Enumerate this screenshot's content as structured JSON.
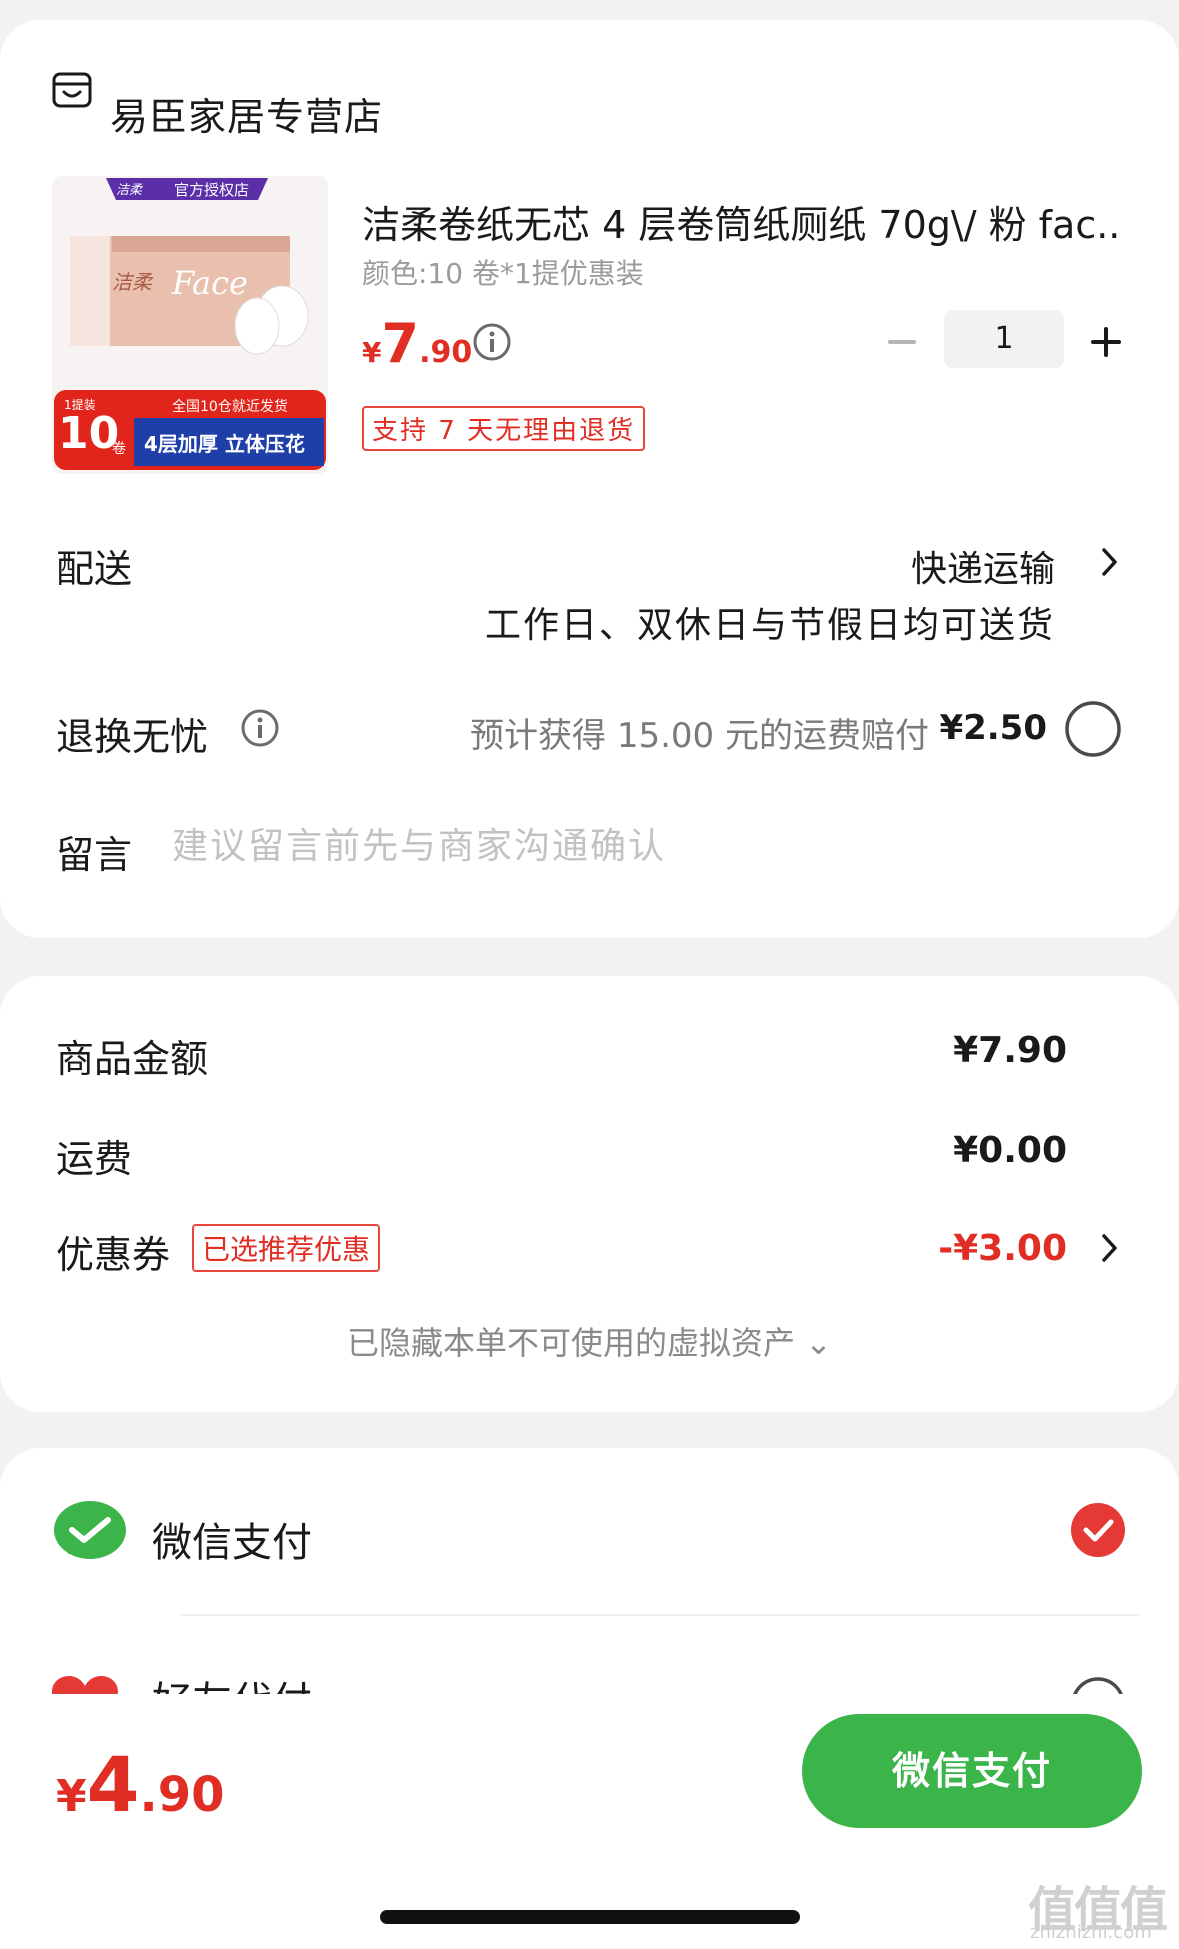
{
  "store": {
    "name": "易臣家居专营店",
    "icon": "store-icon"
  },
  "product": {
    "title": "洁柔卷纸无芯 4 层卷筒纸厕纸 70g\\/ 粉 fac...",
    "variant": "颜色:10 卷*1提优惠装",
    "price_currency": "¥",
    "price_int": "7",
    "price_dec": ".90",
    "quantity": "1",
    "return_badge": "支持 7 天无理由退货",
    "image": {
      "brand_tag": "官方授权店",
      "brand_logo": "洁柔",
      "box_text": "Face",
      "pack_count": "10",
      "pack_unit": "卷",
      "pack_top": "1提装",
      "banner_top": "全国10仓就近发货",
      "banner_main": "4层加厚 立体压花"
    }
  },
  "delivery": {
    "label": "配送",
    "method": "快递运输",
    "note": "工作日、双休日与节假日均可送货"
  },
  "return_service": {
    "label": "退换无忧",
    "desc": "预计获得 15.00 元的运费赔付",
    "price": "¥2.50"
  },
  "message": {
    "label": "留言",
    "placeholder": "建议留言前先与商家沟通确认"
  },
  "summary": {
    "goods_label": "商品金额",
    "goods_value": "¥7.90",
    "shipping_label": "运费",
    "shipping_value": "¥0.00",
    "coupon_label": "优惠券",
    "coupon_tag": "已选推荐优惠",
    "coupon_value": "-¥3.00",
    "hidden_assets": "已隐藏本单不可使用的虚拟资产 ⌄"
  },
  "payment": {
    "wechat_label": "微信支付",
    "friend_label": "好友代付"
  },
  "footer": {
    "total_currency": "¥",
    "total_int": "4",
    "total_dec": ".90",
    "pay_button": "微信支付",
    "watermark": "值值值",
    "watermark_url": "zhizhizhi.com"
  },
  "colors": {
    "accent_red": "#e02e24",
    "wechat_green": "#3bb44a",
    "background": "#f2f2f2"
  }
}
